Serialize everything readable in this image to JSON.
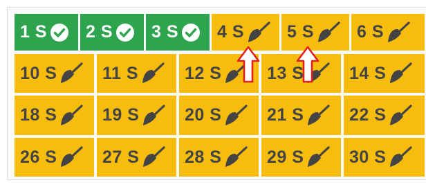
{
  "tiles": [
    {
      "label": "1 S",
      "status": "done",
      "icon": "check-circle-icon"
    },
    {
      "label": "2 S",
      "status": "done",
      "icon": "check-circle-icon"
    },
    {
      "label": "3 S",
      "status": "done",
      "icon": "check-circle-icon"
    },
    {
      "label": "4 S",
      "status": "todo",
      "icon": "broom-icon"
    },
    {
      "label": "5 S",
      "status": "todo",
      "icon": "broom-icon"
    },
    {
      "label": "6 S",
      "status": "todo",
      "icon": "broom-icon"
    },
    {
      "label": "10 S",
      "status": "todo",
      "icon": "broom-icon"
    },
    {
      "label": "11 S",
      "status": "todo",
      "icon": "broom-icon"
    },
    {
      "label": "12 S",
      "status": "todo",
      "icon": "broom-icon"
    },
    {
      "label": "13 S",
      "status": "todo",
      "icon": "broom-icon"
    },
    {
      "label": "14 S",
      "status": "todo",
      "icon": "broom-icon"
    },
    {
      "label": "18 S",
      "status": "todo",
      "icon": "broom-icon"
    },
    {
      "label": "19 S",
      "status": "todo",
      "icon": "broom-icon"
    },
    {
      "label": "20 S",
      "status": "todo",
      "icon": "broom-icon"
    },
    {
      "label": "21 S",
      "status": "todo",
      "icon": "broom-icon"
    },
    {
      "label": "22 S",
      "status": "todo",
      "icon": "broom-icon"
    },
    {
      "label": "26 S",
      "status": "todo",
      "icon": "broom-icon"
    },
    {
      "label": "27 S",
      "status": "todo",
      "icon": "broom-icon"
    },
    {
      "label": "28 S",
      "status": "todo",
      "icon": "broom-icon"
    },
    {
      "label": "29 S",
      "status": "todo",
      "icon": "broom-icon"
    },
    {
      "label": "30 S",
      "status": "todo",
      "icon": "broom-icon"
    }
  ],
  "colors": {
    "done": "#2ea44f",
    "todo": "#f7bd0e",
    "todo_text": "#444444",
    "arrow_stroke": "#e0201b"
  },
  "annotations": [
    "up-arrow-icon",
    "up-arrow-icon"
  ]
}
